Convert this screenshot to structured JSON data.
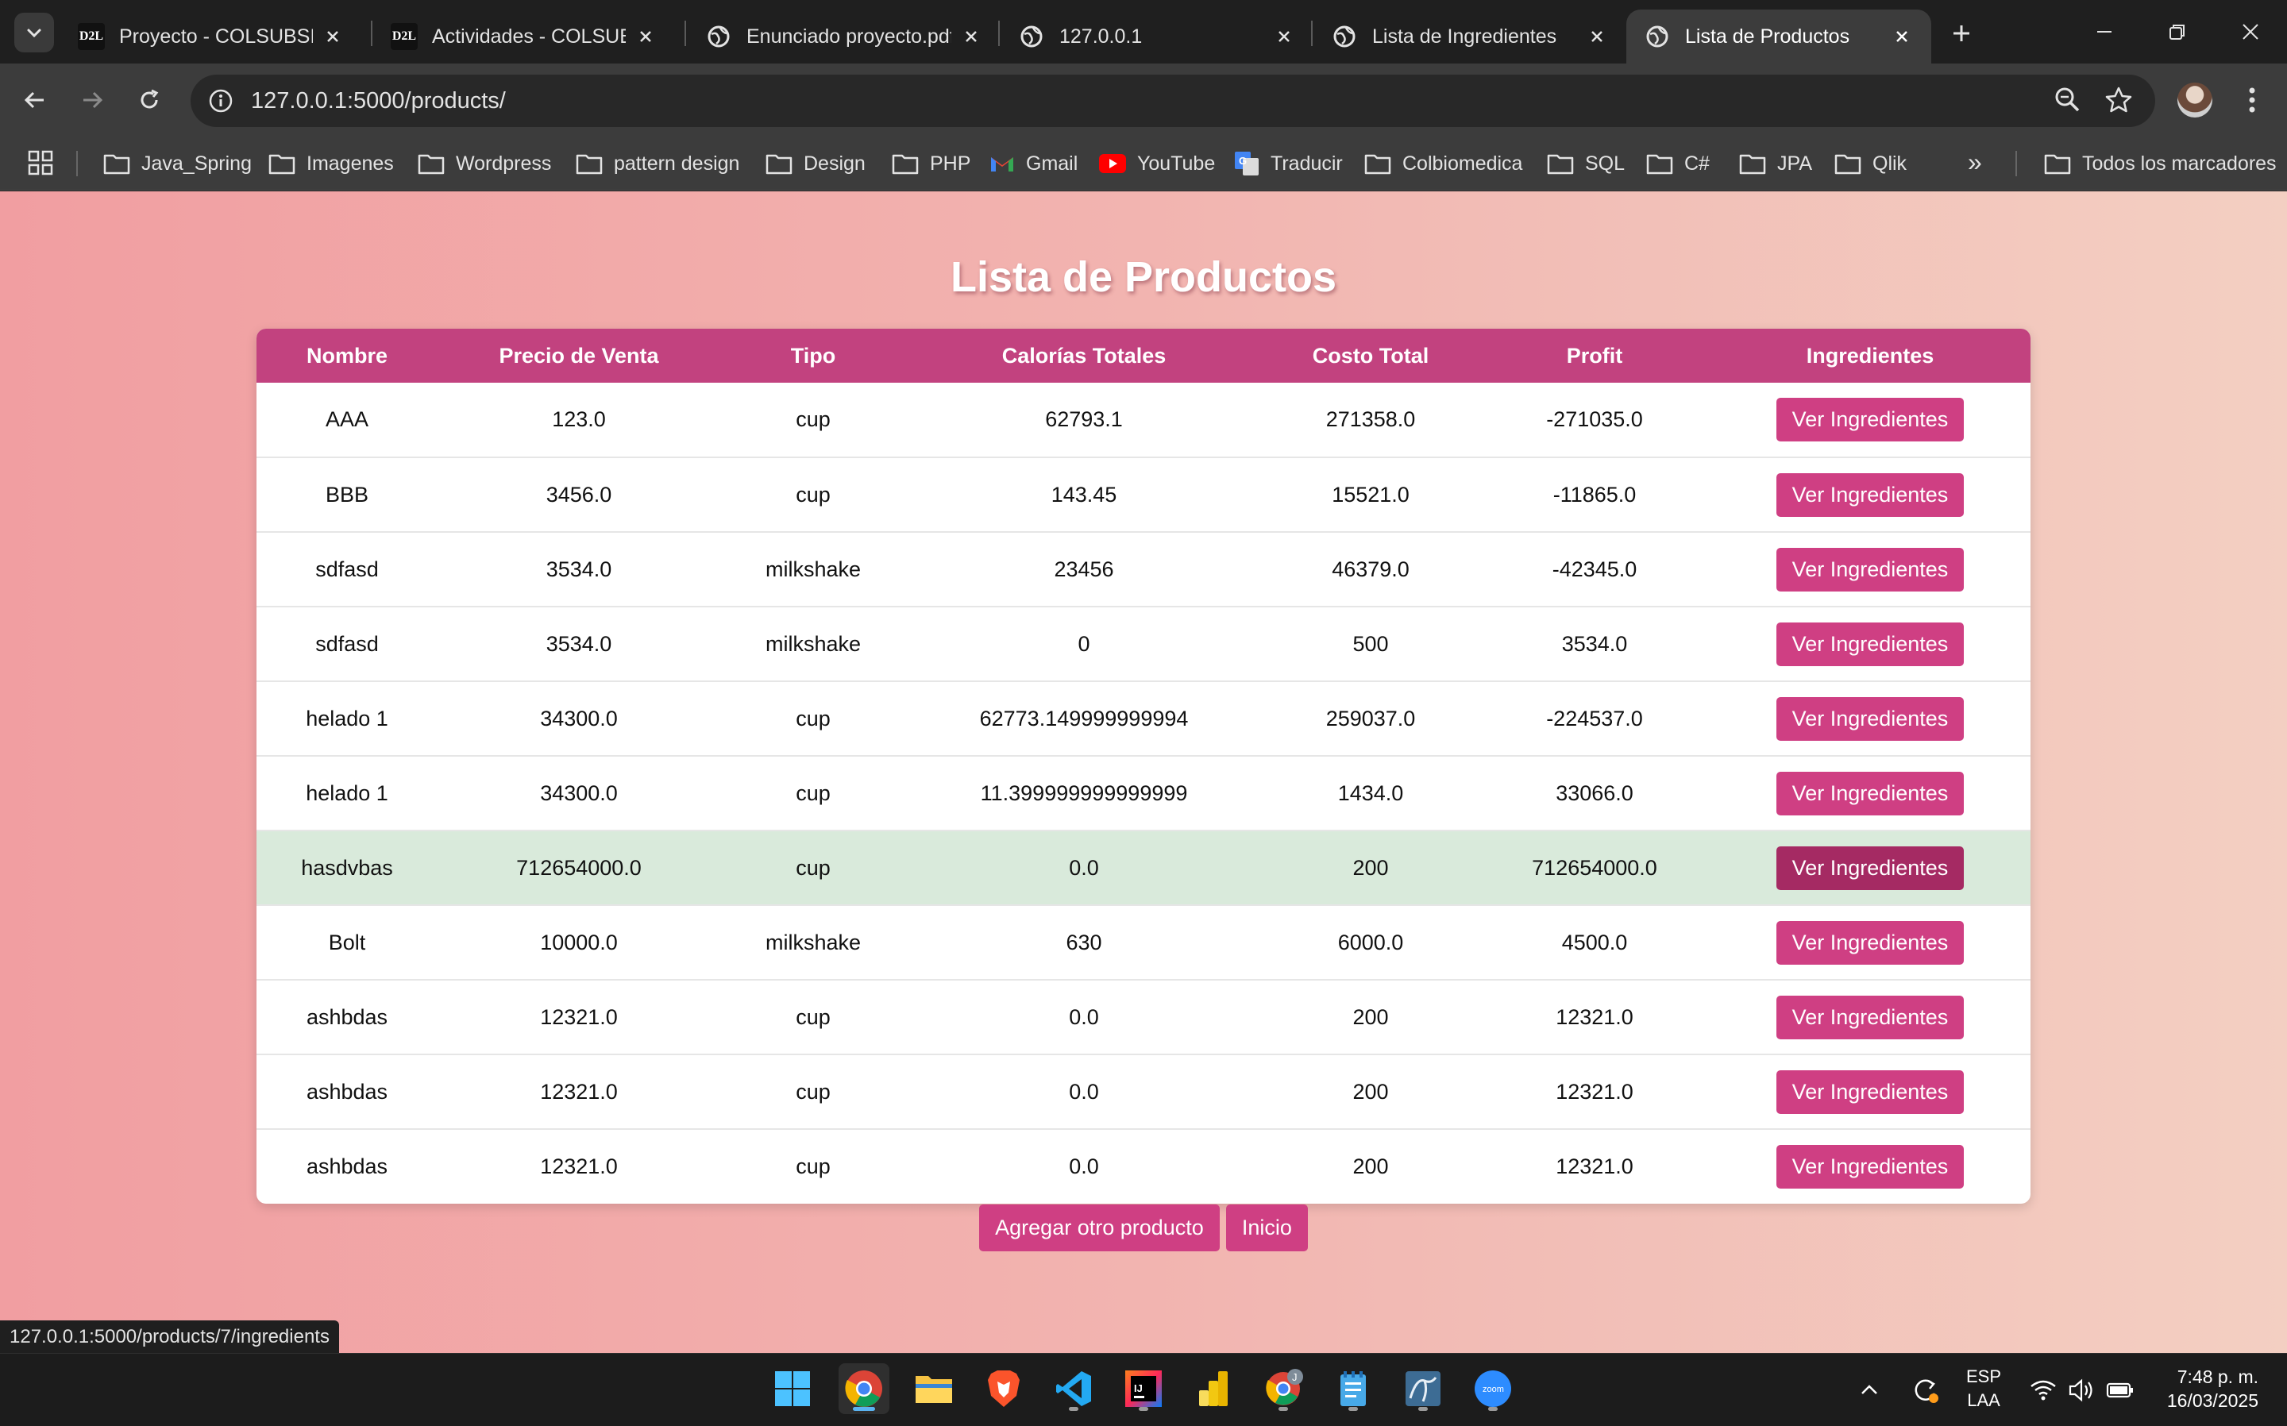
{
  "browser": {
    "tabs": [
      {
        "title": "Proyecto - COLSUBSIDIO",
        "favicon": "d2l-icon"
      },
      {
        "title": "Actividades - COLSUBSIDIO",
        "favicon": "d2l-icon"
      },
      {
        "title": "Enunciado proyecto.pdf",
        "favicon": "globe-icon"
      },
      {
        "title": "127.0.0.1",
        "favicon": "globe-icon"
      },
      {
        "title": "Lista de Ingredientes",
        "favicon": "globe-icon"
      },
      {
        "title": "Lista de Productos",
        "favicon": "globe-icon",
        "active": true
      }
    ],
    "favicon_text": "D2L",
    "url": "127.0.0.1:5000/products/",
    "bookmarks": [
      {
        "label": "Java_Spring",
        "icon": "folder-icon"
      },
      {
        "label": "Imagenes",
        "icon": "folder-icon"
      },
      {
        "label": "Wordpress",
        "icon": "folder-icon"
      },
      {
        "label": "pattern design",
        "icon": "folder-icon"
      },
      {
        "label": "Design",
        "icon": "folder-icon"
      },
      {
        "label": "PHP",
        "icon": "folder-icon"
      },
      {
        "label": "Gmail",
        "icon": "gmail-icon"
      },
      {
        "label": "YouTube",
        "icon": "youtube-icon"
      },
      {
        "label": "Traducir",
        "icon": "translate-icon"
      },
      {
        "label": "Colbiomedica",
        "icon": "folder-icon"
      },
      {
        "label": "SQL",
        "icon": "folder-icon"
      },
      {
        "label": "C#",
        "icon": "folder-icon"
      },
      {
        "label": "JPA",
        "icon": "folder-icon"
      },
      {
        "label": "Qlik",
        "icon": "folder-icon"
      }
    ],
    "all_bookmarks_label": "Todos los marcadores",
    "more_bookmarks": "»",
    "status_url": "127.0.0.1:5000/products/7/ingredients"
  },
  "page": {
    "title": "Lista de Productos",
    "columns": [
      "Nombre",
      "Precio de Venta",
      "Tipo",
      "Calorías Totales",
      "Costo Total",
      "Profit",
      "Ingredientes"
    ],
    "rows": [
      {
        "nombre": "AAA",
        "precio": "123.0",
        "tipo": "cup",
        "calorias": "62793.1",
        "costo": "271358.0",
        "profit": "-271035.0"
      },
      {
        "nombre": "BBB",
        "precio": "3456.0",
        "tipo": "cup",
        "calorias": "143.45",
        "costo": "15521.0",
        "profit": "-11865.0"
      },
      {
        "nombre": "sdfasd",
        "precio": "3534.0",
        "tipo": "milkshake",
        "calorias": "23456",
        "costo": "46379.0",
        "profit": "-42345.0"
      },
      {
        "nombre": "sdfasd",
        "precio": "3534.0",
        "tipo": "milkshake",
        "calorias": "0",
        "costo": "500",
        "profit": "3534.0"
      },
      {
        "nombre": "helado 1",
        "precio": "34300.0",
        "tipo": "cup",
        "calorias": "62773.149999999994",
        "costo": "259037.0",
        "profit": "-224537.0"
      },
      {
        "nombre": "helado 1",
        "precio": "34300.0",
        "tipo": "cup",
        "calorias": "11.399999999999999",
        "costo": "1434.0",
        "profit": "33066.0"
      },
      {
        "nombre": "hasdvbas",
        "precio": "712654000.0",
        "tipo": "cup",
        "calorias": "0.0",
        "costo": "200",
        "profit": "712654000.0",
        "highlighted": true
      },
      {
        "nombre": "Bolt",
        "precio": "10000.0",
        "tipo": "milkshake",
        "calorias": "630",
        "costo": "6000.0",
        "profit": "4500.0"
      },
      {
        "nombre": "ashbdas",
        "precio": "12321.0",
        "tipo": "cup",
        "calorias": "0.0",
        "costo": "200",
        "profit": "12321.0"
      },
      {
        "nombre": "ashbdas",
        "precio": "12321.0",
        "tipo": "cup",
        "calorias": "0.0",
        "costo": "200",
        "profit": "12321.0"
      },
      {
        "nombre": "ashbdas",
        "precio": "12321.0",
        "tipo": "cup",
        "calorias": "0.0",
        "costo": "200",
        "profit": "12321.0"
      }
    ],
    "row_button_label": "Ver Ingredientes",
    "add_product_label": "Agregar otro producto",
    "home_label": "Inicio",
    "colors": {
      "header": "#c2427f",
      "button": "#cf3f83",
      "highlight_row": "#d9eadb"
    }
  },
  "taskbar": {
    "apps": [
      "windows-start-icon",
      "chrome-icon",
      "file-explorer-icon",
      "brave-icon",
      "vscode-icon",
      "intellij-icon",
      "power-bi-icon",
      "chrome-profile-icon",
      "notepad-icon",
      "mysql-workbench-icon",
      "zoom-icon"
    ],
    "chrome_profile_letter": "J",
    "zoom_label": "zoom",
    "language_line1": "ESP",
    "language_line2": "LAA",
    "time": "7:48 p. m.",
    "date": "16/03/2025"
  }
}
